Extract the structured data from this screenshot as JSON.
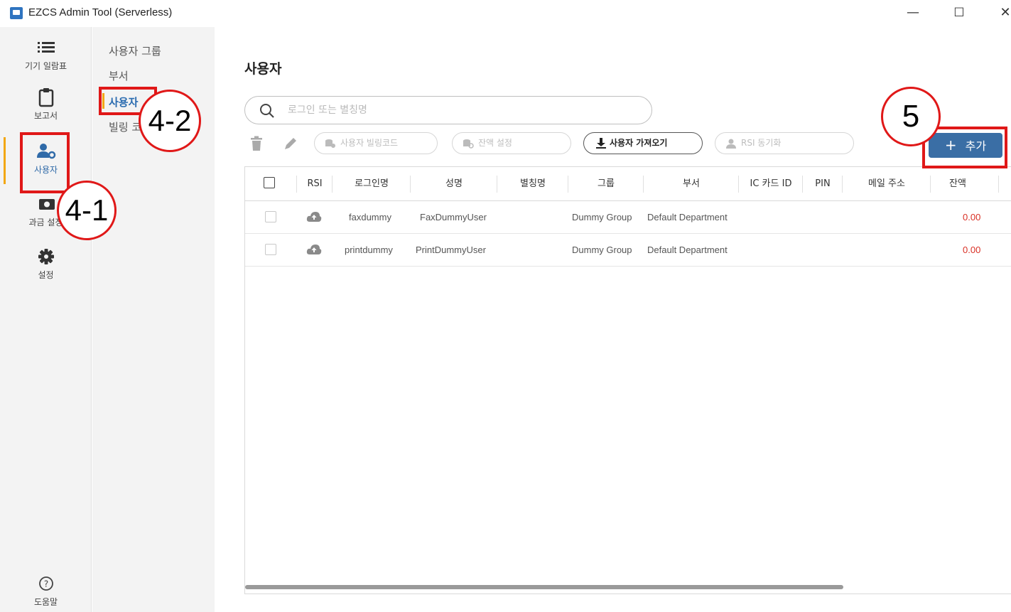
{
  "window": {
    "title": "EZCS Admin Tool (Serverless)",
    "minimize": "—",
    "maximize": "☐",
    "close": "✕"
  },
  "leftnav": {
    "items": [
      {
        "label": "기기 일람표",
        "icon": "list-icon"
      },
      {
        "label": "보고서",
        "icon": "clipboard-icon"
      },
      {
        "label": "사용자",
        "icon": "users-gear-icon"
      },
      {
        "label": "과금 설정",
        "icon": "billing-icon"
      },
      {
        "label": "설정",
        "icon": "gear-icon"
      }
    ],
    "help": {
      "label": "도움말",
      "icon": "help-circle-icon"
    }
  },
  "subnav": {
    "items": [
      {
        "label": "사용자 그룹"
      },
      {
        "label": "부서"
      },
      {
        "label": "사용자"
      },
      {
        "label": "빌링 코"
      }
    ]
  },
  "main": {
    "title": "사용자",
    "search": {
      "placeholder": "로그인 또는 별칭명",
      "value": ""
    },
    "toolbar": {
      "billing_code": "사용자 빌링코드",
      "balance_setting": "잔액 설정",
      "import_users": "사용자 가져오기",
      "rsi_sync": "RSI 동기화",
      "add": "추가"
    },
    "table": {
      "columns": [
        "RSI",
        "로그인명",
        "성명",
        "별칭명",
        "그룹",
        "부서",
        "IC 카드 ID",
        "PIN",
        "메일 주소",
        "잔액"
      ],
      "rows": [
        {
          "login": "faxdummy",
          "name": "FaxDummyUser",
          "alias": "",
          "group": "Dummy Group",
          "dept": "Default Department",
          "ic": "",
          "pin": "",
          "email": "",
          "balance": "0.00"
        },
        {
          "login": "printdummy",
          "name": "PrintDummyUser",
          "alias": "",
          "group": "Dummy Group",
          "dept": "Default Department",
          "ic": "",
          "pin": "",
          "email": "",
          "balance": "0.00"
        }
      ]
    }
  },
  "annotations": {
    "a41": "4-1",
    "a42": "4-2",
    "a5": "5"
  },
  "colors": {
    "accent": "#3a6ea5",
    "active_marker": "#f2a712",
    "annotation": "#e01818",
    "balance": "#d93025"
  }
}
